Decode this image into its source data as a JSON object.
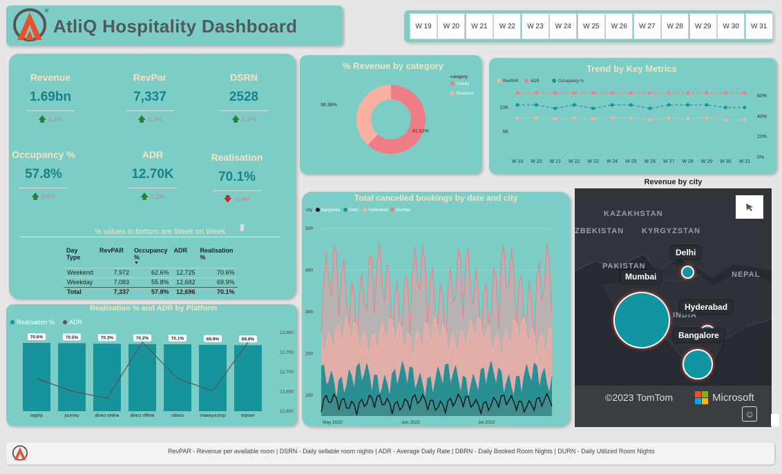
{
  "header": {
    "title": "AtliQ Hospitality Dashboard"
  },
  "weeks": [
    "W 19",
    "W 20",
    "W 21",
    "W 22",
    "W 23",
    "W 24",
    "W 25",
    "W 26",
    "W 27",
    "W 28",
    "W 29",
    "W 30",
    "W 31"
  ],
  "kpis": [
    {
      "label": "Revenue",
      "value": "1.69bn",
      "delta": "0.2%",
      "dir": "up"
    },
    {
      "label": "RevPar",
      "value": "7,337",
      "delta": "0.2%",
      "dir": "up"
    },
    {
      "label": "DSRN",
      "value": "2528",
      "delta": "0.2%",
      "dir": "up"
    },
    {
      "label": "Occupancy %",
      "value": "57.8%",
      "delta": "0.0%",
      "dir": "up"
    },
    {
      "label": "ADR",
      "value": "12.70K",
      "delta": "0.2%",
      "dir": "up"
    },
    {
      "label": "Realisation",
      "value": "70.1%",
      "delta": "-0.0%",
      "dir": "down"
    }
  ],
  "note": "% values in bottom are Week on Week",
  "day_type_table": {
    "headers": [
      "Day Type",
      "RevPAR",
      "Occupancy %",
      "ADR",
      "Realisation %"
    ],
    "rows": [
      [
        "Weekend",
        "7,972",
        "62.6%",
        "12,725",
        "70.6%"
      ],
      [
        "Weekday",
        "7,083",
        "55.8%",
        "12,682",
        "69.9%"
      ]
    ],
    "total": [
      "Total",
      "7,337",
      "57.8%",
      "12,696",
      "70.1%"
    ]
  },
  "footer": {
    "text": "RevPAR - Revenue per available room | DSRN - Daily sellable room nights | ADR - Average Daily Rate | DBRN - Daily Booked Room Nights | DURN - Daily Utilized Room Nights"
  },
  "chart_data": [
    {
      "type": "pie",
      "title": "% Revenue by category",
      "legend_title": "category",
      "labels": [
        "Luxury",
        "Business"
      ],
      "values": [
        61.62,
        38.38
      ],
      "value_labels": [
        "61.62%",
        "38.38%"
      ],
      "colors": [
        "#f07c86",
        "#f9b0a1"
      ],
      "legend": "top-right"
    },
    {
      "type": "line",
      "title": "Trend by Key Metrics",
      "categories": [
        "W 19",
        "W 20",
        "W 21",
        "W 22",
        "W 23",
        "W 24",
        "W 25",
        "W 26",
        "W 27",
        "W 28",
        "W 29",
        "W 30",
        "W 31"
      ],
      "y_ticks_left": [
        "5K",
        "10K"
      ],
      "y_ticks_right": [
        "0%",
        "20%",
        "40%",
        "60%"
      ],
      "ylim_left": [
        0,
        15000
      ],
      "ylim_right": [
        0,
        0.8
      ],
      "series": [
        {
          "name": "RevPAR",
          "axis": "left",
          "color": "#f9b0a1",
          "values": [
            7300,
            7300,
            7150,
            7350,
            7150,
            7400,
            7300,
            7000,
            7350,
            7250,
            7400,
            6900,
            7000
          ]
        },
        {
          "name": "ADR",
          "axis": "left",
          "color": "#f07c86",
          "values": [
            12700,
            12700,
            12700,
            12700,
            12700,
            12700,
            12700,
            12700,
            12700,
            12700,
            12700,
            12700,
            12700
          ]
        },
        {
          "name": "Occupancy %",
          "axis": "right",
          "color": "#17939c",
          "values": [
            0.58,
            0.58,
            0.54,
            0.58,
            0.54,
            0.58,
            0.58,
            0.54,
            0.58,
            0.58,
            0.58,
            0.55,
            0.55
          ]
        }
      ]
    },
    {
      "type": "bar",
      "title": "Realisation % and ADR by Platform",
      "categories": [
        "logtrip",
        "journey",
        "direct online",
        "direct offline",
        "others",
        "makeyourtrip",
        "tripster"
      ],
      "y_ticks_right": [
        "12,600",
        "12,650",
        "12,700",
        "12,750",
        "12,800"
      ],
      "ylim_right": [
        12600,
        12800
      ],
      "series": [
        {
          "name": "Realisation %",
          "color": "#17939c",
          "values": [
            70.6,
            70.5,
            70.3,
            70.2,
            70.1,
            69.9,
            69.8
          ],
          "value_labels": [
            "70.6%",
            "70.5%",
            "70.3%",
            "70.2%",
            "70.1%",
            "69.9%",
            "69.8%"
          ]
        },
        {
          "name": "ADR",
          "color": "#555555",
          "values": [
            12700,
            12665,
            12645,
            12800,
            12700,
            12665,
            12800
          ]
        }
      ]
    },
    {
      "type": "area",
      "title": "Total cancelled bookings by date and  city",
      "legend_title": "city",
      "y_ticks": [
        "100",
        "200",
        "300",
        "400",
        "500"
      ],
      "ylim": [
        50,
        530
      ],
      "x_ticks": [
        "May 2022",
        "Jun 2022",
        "Jul 2022"
      ],
      "series": [
        {
          "name": "Bangalore",
          "color": "#111111",
          "base": 70,
          "amp": 35
        },
        {
          "name": "Delhi",
          "color": "#17939c",
          "base": 115,
          "amp": 70
        },
        {
          "name": "Hyderabad",
          "color": "#f9b0a1",
          "base": 215,
          "amp": 80
        },
        {
          "name": "Mumbai",
          "color": "#f07c86",
          "base": 290,
          "amp": 190
        }
      ]
    },
    {
      "type": "map",
      "title": "Revenue by city",
      "region_labels": [
        "KAZAKHSTAN",
        "ZBEKISTAN",
        "KYRGYZSTAN",
        "PAKISTAN",
        "NEPAL",
        "INDIA"
      ],
      "cities": [
        {
          "name": "Delhi",
          "value": 0.1
        },
        {
          "name": "Mumbai",
          "value": 1.0
        },
        {
          "name": "Hyderabad",
          "value": 0.15
        },
        {
          "name": "Bangalore",
          "value": 0.45
        }
      ],
      "attribution": "©2023 TomTom",
      "brand": "Microsoft"
    }
  ]
}
